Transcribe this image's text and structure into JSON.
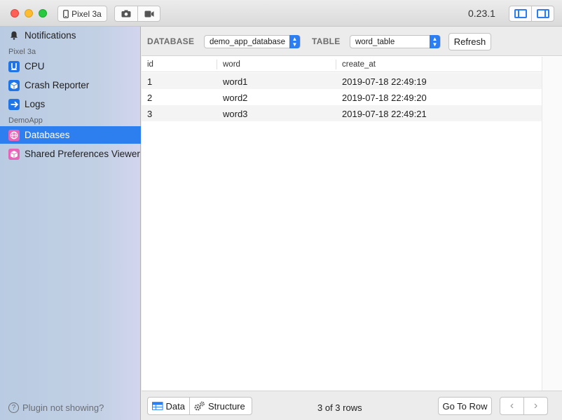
{
  "titlebar": {
    "device_label": "Pixel 3a",
    "version": "0.23.1",
    "icons": [
      "phone-icon",
      "camera-icon",
      "video-icon",
      "left-panel-icon",
      "right-panel-icon"
    ]
  },
  "sidebar": {
    "notifications": "Notifications",
    "section_device": "Pixel 3a",
    "device_items": [
      {
        "label": "CPU",
        "icon": "cpu-icon"
      },
      {
        "label": "Crash Reporter",
        "icon": "cube-icon"
      },
      {
        "label": "Logs",
        "icon": "arrow-right-icon"
      }
    ],
    "section_app": "DemoApp",
    "app_items": [
      {
        "label": "Databases",
        "icon": "globe-icon",
        "active": true
      },
      {
        "label": "Shared Preferences Viewer",
        "icon": "cube-icon"
      }
    ],
    "plugin_help": "Plugin not showing?"
  },
  "toolbar": {
    "database_label": "DATABASE",
    "database_value": "demo_app_database",
    "table_label": "TABLE",
    "table_value": "word_table",
    "refresh_label": "Refresh"
  },
  "table": {
    "columns": [
      "id",
      "word",
      "create_at"
    ],
    "rows": [
      [
        "1",
        "word1",
        "2019-07-18 22:49:19"
      ],
      [
        "2",
        "word2",
        "2019-07-18 22:49:20"
      ],
      [
        "3",
        "word3",
        "2019-07-18 22:49:21"
      ]
    ]
  },
  "footer": {
    "data_tab": "Data",
    "structure_tab": "Structure",
    "row_count": "3 of 3 rows",
    "goto_label": "Go To Row",
    "prev_glyph": "‹",
    "next_glyph": "›"
  },
  "colors": {
    "accent": "#2d7ff0",
    "sidebar_bg": "#c2d0e4"
  }
}
